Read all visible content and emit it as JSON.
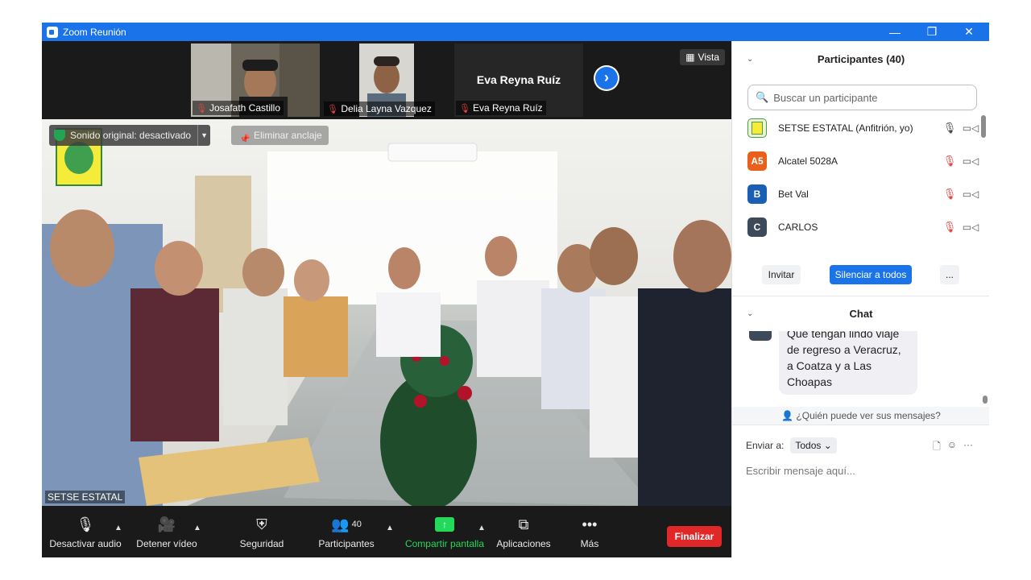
{
  "window": {
    "title": "Zoom Reunión",
    "minimize": "—",
    "restore": "❐",
    "close": "✕"
  },
  "strip": {
    "vista": "Vista",
    "thumbnails": [
      {
        "name": "Josafath Castillo"
      },
      {
        "name": "Delia Layna Vazquez"
      },
      {
        "name": "Eva Reyna Ruíz",
        "display_name": "Eva Reyna Ruíz"
      }
    ],
    "next_arrow": "›"
  },
  "main_video": {
    "sonido_original": "Sonido original: desactivado",
    "eliminar_anclaje": "Eliminar anclaje",
    "participant_name": "SETSE ESTATAL"
  },
  "toolbar": {
    "audio": "Desactivar audio",
    "video": "Detener vídeo",
    "security": "Seguridad",
    "participants": "Participantes",
    "participants_count": "40",
    "share": "Compartir pantalla",
    "apps": "Aplicaciones",
    "more": "Más",
    "end": "Finalizar",
    "share_color": "#23d959",
    "end_color": "#e02828"
  },
  "participants_panel": {
    "title": "Participantes (40)",
    "search_placeholder": "Buscar un participante",
    "list": [
      {
        "avatar": "",
        "name": "SETSE ESTATAL (Anfitrión, yo)",
        "mic": "on",
        "color": "#f3f0d0"
      },
      {
        "avatar": "A5",
        "name": "Alcatel 5028A",
        "mic": "off",
        "color": "#e8601c"
      },
      {
        "avatar": "B",
        "name": "Bet Val",
        "mic": "off",
        "color": "#1a5fb4"
      },
      {
        "avatar": "C",
        "name": "CARLOS",
        "mic": "off",
        "color": "#3c4a5a"
      }
    ],
    "invite": "Invitar",
    "mute_all": "Silenciar a todos",
    "more": "..."
  },
  "chat": {
    "title": "Chat",
    "message": "Que tengan lindo viaje de regreso a Veracruz, a Coatza y a Las Choapas",
    "who_can_see": "¿Quién puede ver sus mensajes?",
    "send_to_label": "Enviar a:",
    "send_to_value": "Todos",
    "input_placeholder": "Escribir mensaje aquí..."
  }
}
